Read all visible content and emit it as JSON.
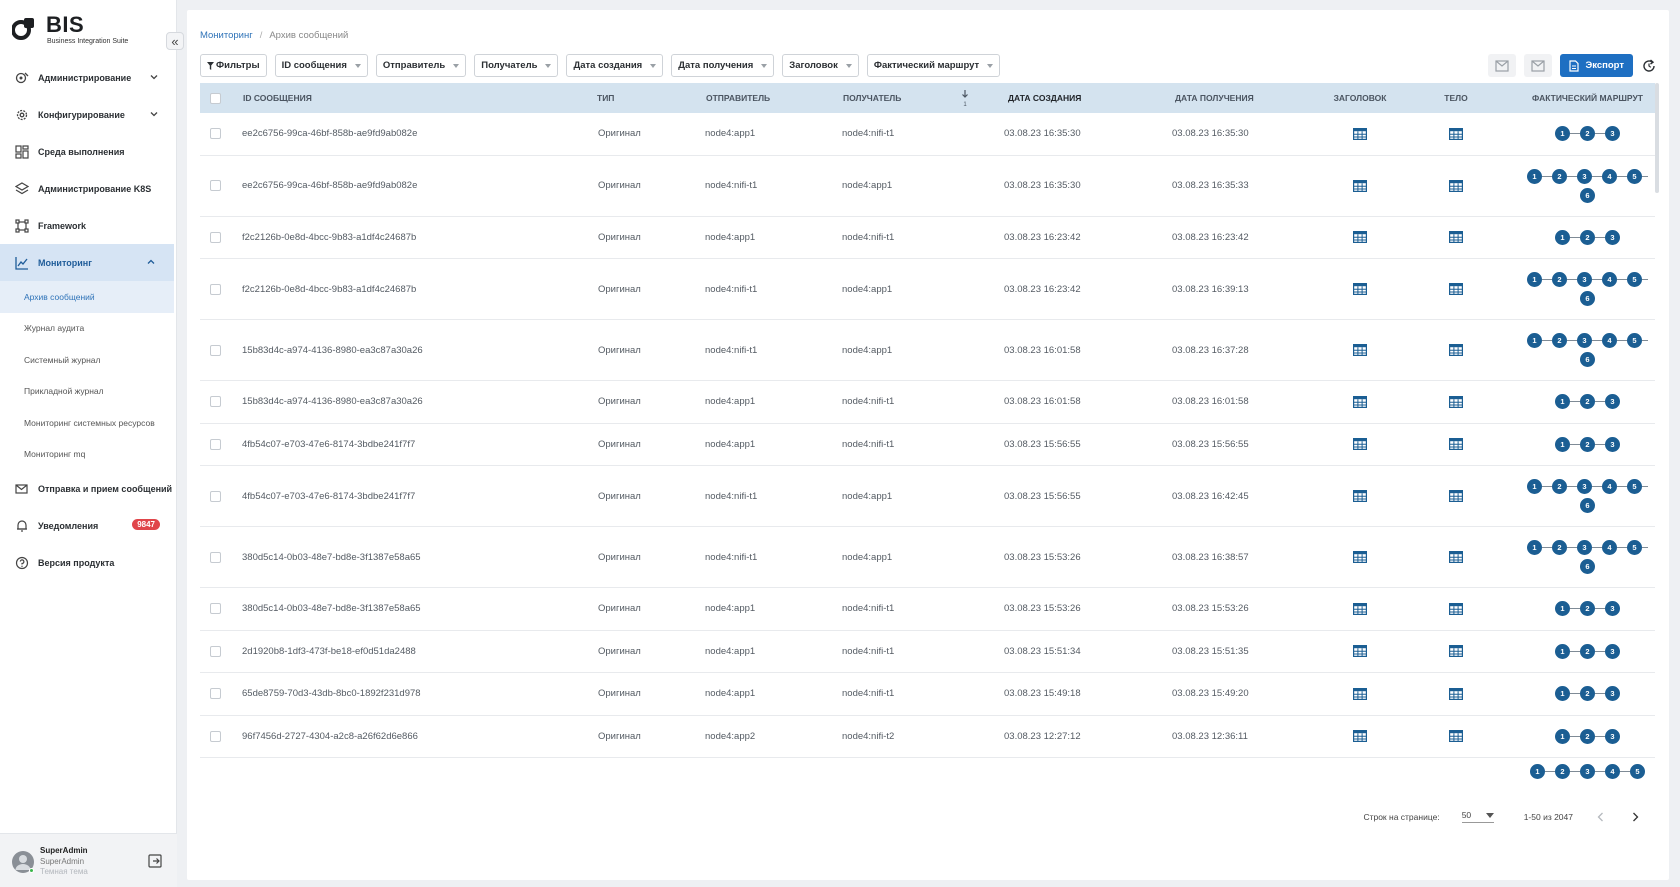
{
  "app": {
    "title": "BIS",
    "subtitle": "Business Integration Suite"
  },
  "sidebar": {
    "collapse_glyph": "«",
    "items": [
      {
        "label": "Администрирование",
        "icon": "shield-gear-icon",
        "chevron": "down"
      },
      {
        "label": "Конфигурирование",
        "icon": "gear-icon",
        "chevron": "down"
      },
      {
        "label": "Среда выполнения",
        "icon": "dashboard-icon"
      },
      {
        "label": "Администрирование K8S",
        "icon": "layers-icon"
      },
      {
        "label": "Framework",
        "icon": "framework-icon"
      },
      {
        "label": "Мониторинг",
        "icon": "chart-line-icon",
        "chevron": "up",
        "active": true
      }
    ],
    "monitoring_sub": [
      {
        "label": "Архив сообщений",
        "active": true
      },
      {
        "label": "Журнал аудита"
      },
      {
        "label": "Системный журнал"
      },
      {
        "label": "Прикладной журнал"
      },
      {
        "label": "Мониторинг системных ресурсов"
      },
      {
        "label": "Мониторинг mq"
      }
    ],
    "bottom_items": [
      {
        "label": "Отправка и прием сообщений",
        "icon": "mail-send-icon"
      },
      {
        "label": "Уведомления",
        "icon": "bell-icon",
        "badge": "9847"
      },
      {
        "label": "Версия продукта",
        "icon": "help-circle-icon"
      }
    ]
  },
  "user": {
    "name": "SuperAdmin",
    "role": "SuperAdmin",
    "theme": "Темная тема"
  },
  "breadcrumb": {
    "parent": "Мониторинг",
    "separator": "/",
    "current": "Архив сообщений"
  },
  "filters": {
    "filter_label": "Фильтры",
    "dropdowns": [
      "ID сообщения",
      "Отправитель",
      "Получатель",
      "Дата создания",
      "Дата получения",
      "Заголовок",
      "Фактический маршрут"
    ]
  },
  "toolbar": {
    "export_label": "Экспорт",
    "accent": "#1e6fc2"
  },
  "table": {
    "columns": {
      "id": "ID сообщения",
      "type": "Тип",
      "sender": "Отправитель",
      "receiver": "Получатель",
      "sort_index": "1",
      "created": "Дата создания",
      "received": "Дата получения",
      "header": "Заголовок",
      "body": "Тело",
      "route": "Фактический маршрут"
    },
    "rows": [
      {
        "id": "ee2c6756-99ca-46bf-858b-ae9fd9ab082e",
        "type": "Оригинал",
        "sender": "node4:app1",
        "receiver": "node4:nifi-t1",
        "created": "03.08.23 16:35:30",
        "received": "03.08.23 16:35:30",
        "route": [
          [
            "1",
            "2",
            "3"
          ]
        ]
      },
      {
        "id": "ee2c6756-99ca-46bf-858b-ae9fd9ab082e",
        "type": "Оригинал",
        "sender": "node4:nifi-t1",
        "receiver": "node4:app1",
        "created": "03.08.23 16:35:30",
        "received": "03.08.23 16:35:33",
        "route": [
          [
            "1",
            "2",
            "3",
            "4",
            "5"
          ],
          [
            "6"
          ]
        ]
      },
      {
        "id": "f2c2126b-0e8d-4bcc-9b83-a1df4c24687b",
        "type": "Оригинал",
        "sender": "node4:app1",
        "receiver": "node4:nifi-t1",
        "created": "03.08.23 16:23:42",
        "received": "03.08.23 16:23:42",
        "route": [
          [
            "1",
            "2",
            "3"
          ]
        ]
      },
      {
        "id": "f2c2126b-0e8d-4bcc-9b83-a1df4c24687b",
        "type": "Оригинал",
        "sender": "node4:nifi-t1",
        "receiver": "node4:app1",
        "created": "03.08.23 16:23:42",
        "received": "03.08.23 16:39:13",
        "route": [
          [
            "1",
            "2",
            "3",
            "4",
            "5"
          ],
          [
            "6"
          ]
        ]
      },
      {
        "id": "15b83d4c-a974-4136-8980-ea3c87a30a26",
        "type": "Оригинал",
        "sender": "node4:nifi-t1",
        "receiver": "node4:app1",
        "created": "03.08.23 16:01:58",
        "received": "03.08.23 16:37:28",
        "route": [
          [
            "1",
            "2",
            "3",
            "4",
            "5"
          ],
          [
            "6"
          ]
        ]
      },
      {
        "id": "15b83d4c-a974-4136-8980-ea3c87a30a26",
        "type": "Оригинал",
        "sender": "node4:app1",
        "receiver": "node4:nifi-t1",
        "created": "03.08.23 16:01:58",
        "received": "03.08.23 16:01:58",
        "route": [
          [
            "1",
            "2",
            "3"
          ]
        ]
      },
      {
        "id": "4fb54c07-e703-47e6-8174-3bdbe241f7f7",
        "type": "Оригинал",
        "sender": "node4:app1",
        "receiver": "node4:nifi-t1",
        "created": "03.08.23 15:56:55",
        "received": "03.08.23 15:56:55",
        "route": [
          [
            "1",
            "2",
            "3"
          ]
        ]
      },
      {
        "id": "4fb54c07-e703-47e6-8174-3bdbe241f7f7",
        "type": "Оригинал",
        "sender": "node4:nifi-t1",
        "receiver": "node4:app1",
        "created": "03.08.23 15:56:55",
        "received": "03.08.23 16:42:45",
        "route": [
          [
            "1",
            "2",
            "3",
            "4",
            "5"
          ],
          [
            "6"
          ]
        ]
      },
      {
        "id": "380d5c14-0b03-48e7-bd8e-3f1387e58a65",
        "type": "Оригинал",
        "sender": "node4:nifi-t1",
        "receiver": "node4:app1",
        "created": "03.08.23 15:53:26",
        "received": "03.08.23 16:38:57",
        "route": [
          [
            "1",
            "2",
            "3",
            "4",
            "5"
          ],
          [
            "6"
          ]
        ]
      },
      {
        "id": "380d5c14-0b03-48e7-bd8e-3f1387e58a65",
        "type": "Оригинал",
        "sender": "node4:app1",
        "receiver": "node4:nifi-t1",
        "created": "03.08.23 15:53:26",
        "received": "03.08.23 15:53:26",
        "route": [
          [
            "1",
            "2",
            "3"
          ]
        ]
      },
      {
        "id": "2d1920b8-1df3-473f-be18-ef0d51da2488",
        "type": "Оригинал",
        "sender": "node4:app1",
        "receiver": "node4:nifi-t1",
        "created": "03.08.23 15:51:34",
        "received": "03.08.23 15:51:35",
        "route": [
          [
            "1",
            "2",
            "3"
          ]
        ]
      },
      {
        "id": "65de8759-70d3-43db-8bc0-1892f231d978",
        "type": "Оригинал",
        "sender": "node4:app1",
        "receiver": "node4:nifi-t1",
        "created": "03.08.23 15:49:18",
        "received": "03.08.23 15:49:20",
        "route": [
          [
            "1",
            "2",
            "3"
          ]
        ]
      },
      {
        "id": "96f7456d-2727-4304-a2c8-a26f62d6e866",
        "type": "Оригинал",
        "sender": "node4:app2",
        "receiver": "node4:nifi-t2",
        "created": "03.08.23 12:27:12",
        "received": "03.08.23 12:36:11",
        "route": [
          [
            "1",
            "2",
            "3"
          ]
        ]
      }
    ],
    "partial_row_route": [
      [
        "1",
        "2",
        "3",
        "4",
        "5"
      ]
    ]
  },
  "pagination": {
    "rows_label": "Строк на странице:",
    "rows_value": "50",
    "range": "1-50 из 2047"
  },
  "colors": {
    "route_node": "#1b5e93",
    "header_bg": "#d4e3ef",
    "active_nav": "#d6e4f4",
    "badge": "#e0454a"
  }
}
